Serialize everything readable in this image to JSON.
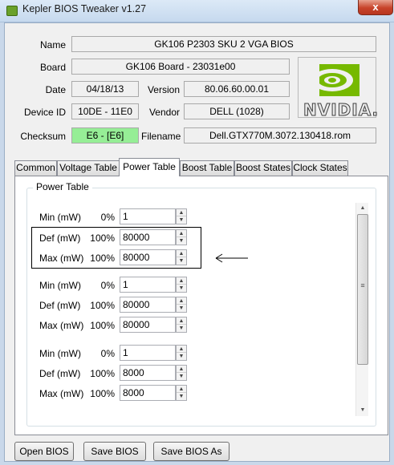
{
  "window": {
    "title": "Kepler BIOS Tweaker v1.27",
    "close_glyph": "x"
  },
  "info": {
    "name_label": "Name",
    "name_value": "GK106 P2303 SKU 2 VGA BIOS",
    "board_label": "Board",
    "board_value": "GK106 Board - 23031e00",
    "date_label": "Date",
    "date_value": "04/18/13",
    "version_label": "Version",
    "version_value": "80.06.60.00.01",
    "device_label": "Device ID",
    "device_value": "10DE - 11E0",
    "vendor_label": "Vendor",
    "vendor_value": "DELL (1028)",
    "checksum_label": "Checksum",
    "checksum_value": "E6 - [E6]",
    "filename_label": "Filename",
    "filename_value": "Dell.GTX770M.3072.130418.rom",
    "checksum_color": "#96ee96"
  },
  "logo": {
    "text": "NVIDIA.",
    "icon": "nvidia-eye-icon",
    "color": "#76b900"
  },
  "tabs": [
    {
      "label": "Common"
    },
    {
      "label": "Voltage Table"
    },
    {
      "label": "Power Table"
    },
    {
      "label": "Boost Table"
    },
    {
      "label": "Boost States"
    },
    {
      "label": "Clock States"
    }
  ],
  "active_tab": "Power Table",
  "power_table": {
    "group_title": "Power Table",
    "rows": [
      {
        "label": "Min (mW)",
        "pct": "0%",
        "value": "1"
      },
      {
        "label": "Def (mW)",
        "pct": "100%",
        "value": "80000"
      },
      {
        "label": "Max (mW)",
        "pct": "100%",
        "value": "80000"
      },
      {
        "label": "Min (mW)",
        "pct": "0%",
        "value": "1"
      },
      {
        "label": "Def (mW)",
        "pct": "100%",
        "value": "80000"
      },
      {
        "label": "Max (mW)",
        "pct": "100%",
        "value": "80000"
      },
      {
        "label": "Min (mW)",
        "pct": "0%",
        "value": "1"
      },
      {
        "label": "Def (mW)",
        "pct": "100%",
        "value": "8000"
      },
      {
        "label": "Max (mW)",
        "pct": "100%",
        "value": "8000"
      }
    ]
  },
  "buttons": {
    "open": "Open BIOS",
    "save": "Save BIOS",
    "save_as": "Save BIOS As"
  }
}
